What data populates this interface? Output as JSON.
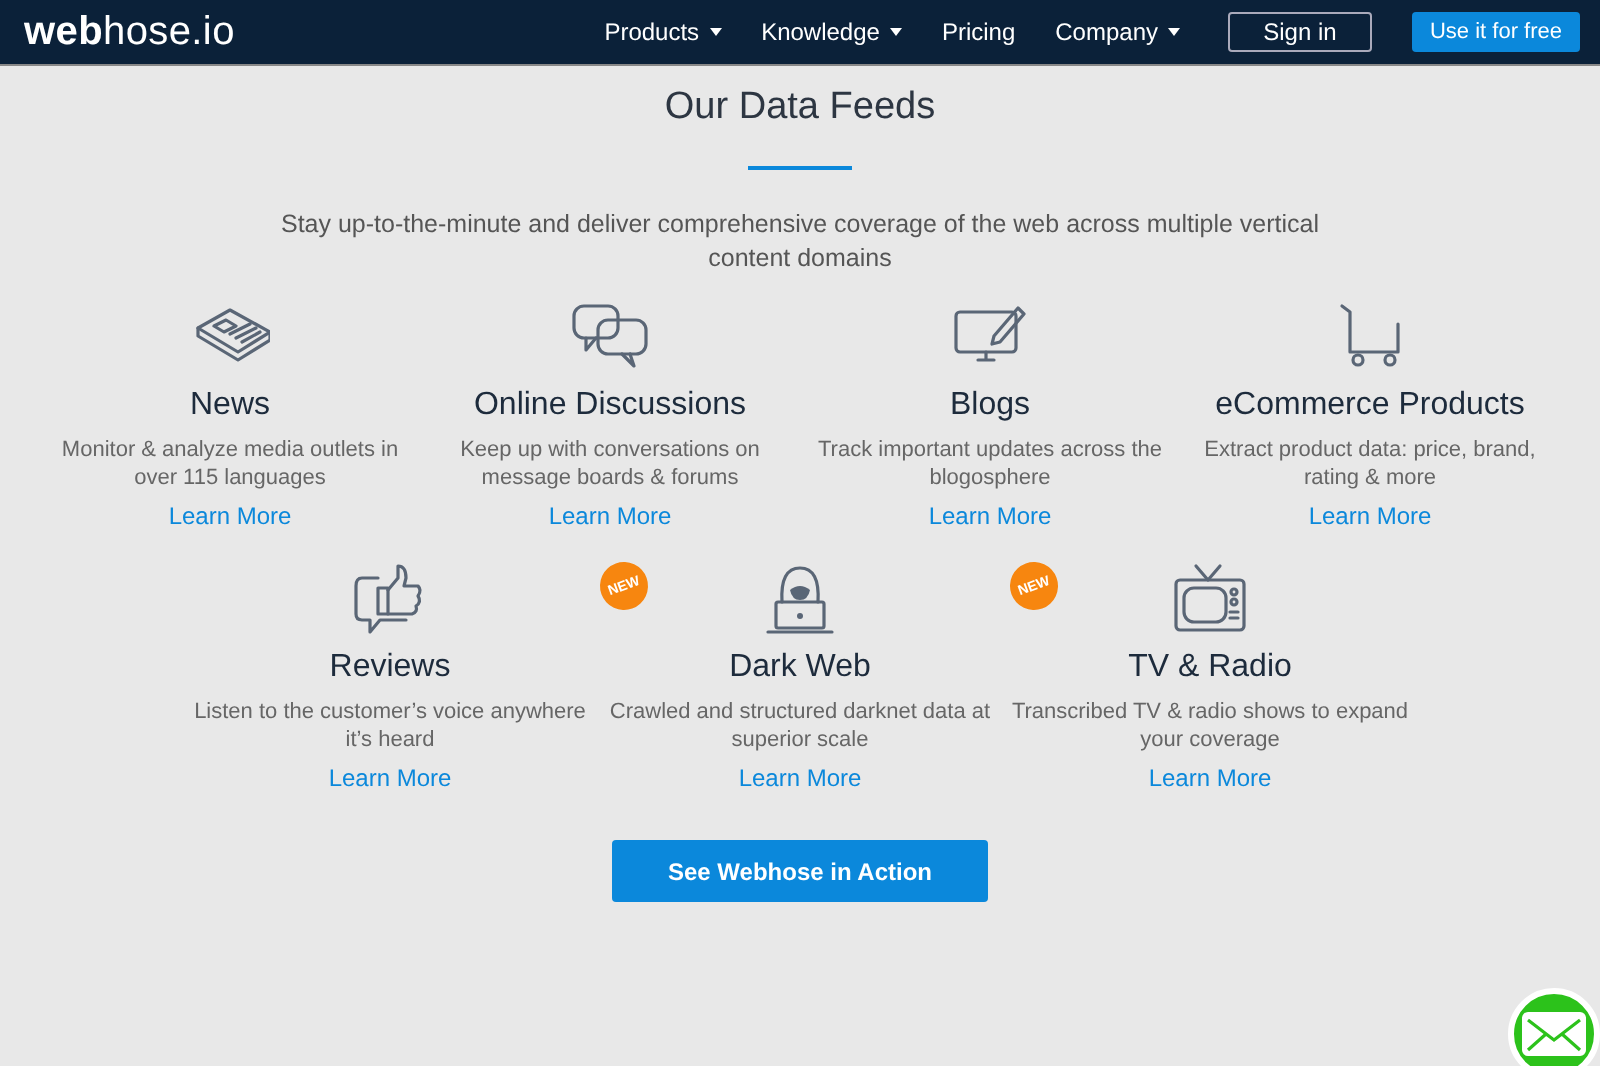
{
  "navbar": {
    "logo": "**web**hose.io",
    "menu": [
      {
        "label": "Products",
        "dropdown": true
      },
      {
        "label": "Knowledge",
        "dropdown": true
      },
      {
        "label": "Pricing",
        "dropdown": false
      },
      {
        "label": "Company",
        "dropdown": true
      }
    ],
    "sign_in": "Sign in",
    "cta": "Use it for free"
  },
  "section": {
    "title": "Our Data Feeds",
    "subtitle": "Stay up-to-the-minute and deliver comprehensive coverage of the web across multiple vertical content domains"
  },
  "feed_rows": [
    {
      "feeds": [
        {
          "kind": "news",
          "title": "News",
          "description": "Monitor & analyze media outlets in over 115 languages",
          "link": "Learn More"
        },
        {
          "kind": "discussions",
          "title": "Online Discussions",
          "description": "Keep up with conversations on message boards & forums",
          "link": "Learn More"
        },
        {
          "kind": "blogs",
          "title": "Blogs",
          "description": "Track important updates across the blogosphere",
          "link": "Learn More"
        },
        {
          "kind": "ecommerce",
          "title": "eCommerce Products",
          "description": "Extract product data: price, brand, rating & more",
          "link": "Learn More"
        }
      ]
    },
    {
      "feeds": [
        {
          "kind": "reviews",
          "title": "Reviews",
          "description": "Listen to the customer’s voice anywhere it’s heard",
          "link": "Learn More"
        },
        {
          "kind": "darkweb",
          "title": "Dark Web",
          "description": "Crawled and structured darknet data at superior scale",
          "link": "Learn More",
          "badge": "NEW"
        },
        {
          "kind": "tv",
          "title": "TV & Radio",
          "description": "Transcribed TV & radio shows to expand your coverage",
          "link": "Learn More",
          "badge": "NEW"
        }
      ]
    }
  ],
  "action_button": "See Webhose in Action"
}
